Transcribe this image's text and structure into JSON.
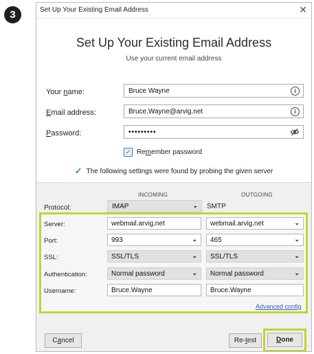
{
  "step": {
    "number": "3"
  },
  "window": {
    "title": "Set Up Your Existing Email Address",
    "close_glyph": "✕"
  },
  "header": {
    "title": "Set Up Your Existing Email Address",
    "subtitle": "Use your current email address"
  },
  "form": {
    "name": {
      "label_pre": "Your ",
      "label_key": "n",
      "label_post": "ame:",
      "value": "Bruce Wayne"
    },
    "email": {
      "label_pre": "",
      "label_key": "E",
      "label_post": "mail address:",
      "value": "Bruce.Wayne@arvig.net"
    },
    "password": {
      "label_pre": "",
      "label_key": "P",
      "label_post": "assword:",
      "value": "•••••••••"
    },
    "remember": {
      "label_pre": "Re",
      "label_key": "m",
      "label_post": "ember password",
      "checked": true
    }
  },
  "info_glyph": "i",
  "found_message": "The following settings were found by probing the given server",
  "settings": {
    "incoming_header": "INCOMING",
    "outgoing_header": "OUTGOING",
    "protocol": {
      "label": "Protocol:",
      "incoming": "IMAP",
      "outgoing": "SMTP"
    },
    "server": {
      "label": "Server:",
      "incoming": "webmail.arvig.net",
      "outgoing": "webmail.arvig.net"
    },
    "port": {
      "label": "Port:",
      "incoming": "993",
      "outgoing": "465"
    },
    "ssl": {
      "label": "SSL:",
      "incoming": "SSL/TLS",
      "outgoing": "SSL/TLS"
    },
    "auth": {
      "label": "Authentication:",
      "incoming": "Normal password",
      "outgoing": "Normal password"
    },
    "username": {
      "label": "Username:",
      "incoming": "Bruce.Wayne",
      "outgoing": "Bruce.Wayne"
    },
    "advanced_pre": "",
    "advanced_key": "A",
    "advanced_post": "dvanced config"
  },
  "buttons": {
    "cancel": {
      "pre": "C",
      "key": "a",
      "post": "ncel"
    },
    "retest": {
      "pre": "Re-",
      "key": "t",
      "post": "est"
    },
    "done": {
      "pre": "",
      "key": "D",
      "post": "one"
    }
  },
  "colors": {
    "highlight": "#c4d42e",
    "link": "#2e62b8",
    "check": "#3aa03a"
  },
  "chevron_glyph": "⌄"
}
